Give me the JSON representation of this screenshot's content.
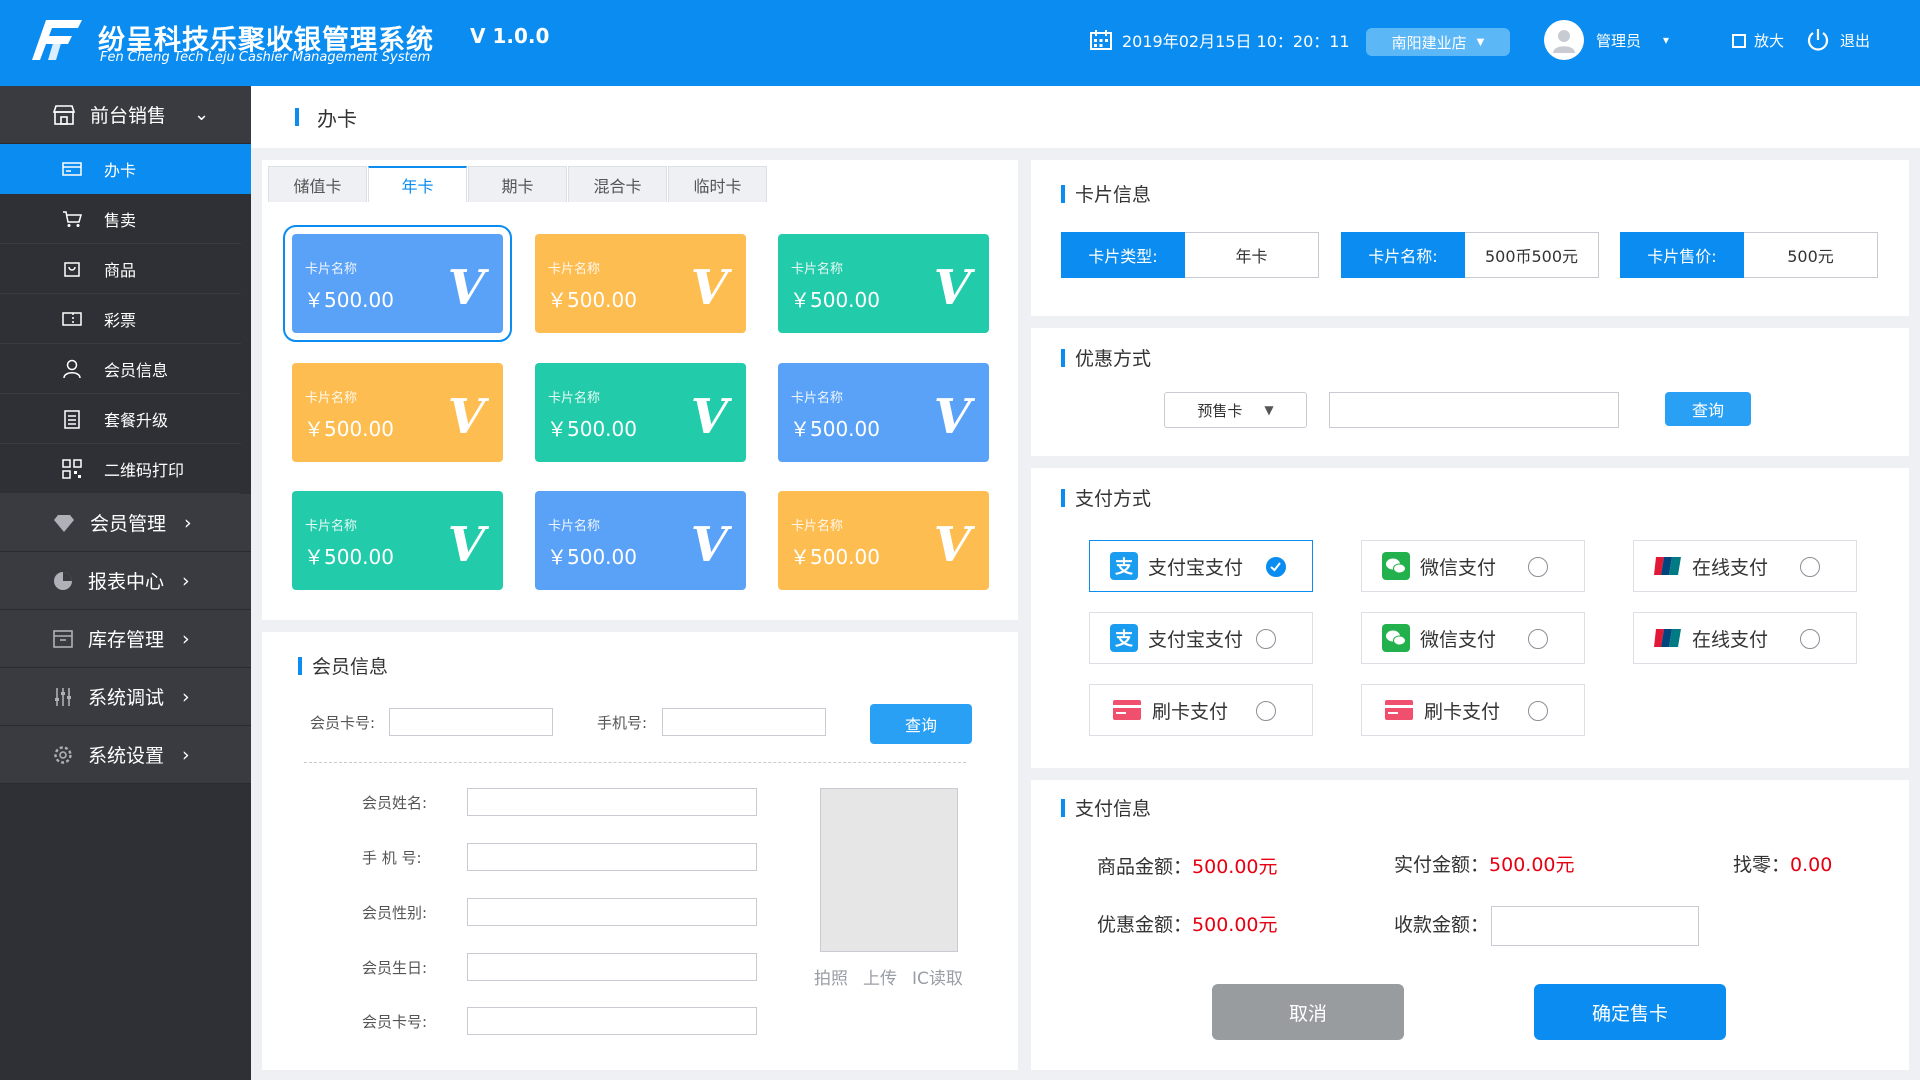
{
  "header": {
    "title": "纷呈科技乐聚收银管理系统",
    "subtitle": "Fen Cheng Tech Leju Cashier Management System",
    "version": "V 1.0.0",
    "datetime": "2019年02月15日  10：20：11",
    "store": "南阳建业店",
    "user": "管理员",
    "zoom_label": "放大",
    "exit_label": "退出",
    "brand_color": "#0a8cf0"
  },
  "sidebar": {
    "groups": [
      {
        "label": "前台销售",
        "icon": "store-icon"
      },
      {
        "label": "会员管理",
        "icon": "diamond-icon"
      },
      {
        "label": "报表中心",
        "icon": "pie-chart-icon"
      },
      {
        "label": "库存管理",
        "icon": "inventory-icon"
      },
      {
        "label": "系统调试",
        "icon": "sliders-icon"
      },
      {
        "label": "系统设置",
        "icon": "gear-icon"
      }
    ],
    "items": [
      {
        "label": "办卡",
        "icon": "card-icon"
      },
      {
        "label": "售卖",
        "icon": "cart-icon"
      },
      {
        "label": "商品",
        "icon": "bag-icon"
      },
      {
        "label": "彩票",
        "icon": "ticket-icon"
      },
      {
        "label": "会员信息",
        "icon": "person-icon"
      },
      {
        "label": "套餐升级",
        "icon": "list-icon"
      },
      {
        "label": "二维码打印",
        "icon": "qrcode-icon"
      }
    ]
  },
  "page": {
    "title": "办卡"
  },
  "tabs": [
    "储值卡",
    "年卡",
    "期卡",
    "混合卡",
    "临时卡"
  ],
  "cards": {
    "name_label": "卡片名称",
    "price": "￥500.00",
    "badge": "V",
    "colors": {
      "blue": "#5aa2f7",
      "orange": "#fdbd50",
      "green": "#22ccaa"
    },
    "items": [
      {
        "color": "blue"
      },
      {
        "color": "orange"
      },
      {
        "color": "green"
      },
      {
        "color": "orange"
      },
      {
        "color": "green"
      },
      {
        "color": "blue"
      },
      {
        "color": "green"
      },
      {
        "color": "blue"
      },
      {
        "color": "orange"
      }
    ]
  },
  "member": {
    "title": "会员信息",
    "card_no_label": "会员卡号:",
    "phone_label": "手机号:",
    "query_label": "查询",
    "fields": [
      "会员姓名:",
      "手 机 号:",
      "会员性别:",
      "会员生日:",
      "会员卡号:"
    ],
    "photo_actions": [
      "拍照",
      "上传",
      "IC读取"
    ]
  },
  "card_info": {
    "title": "卡片信息",
    "type_label": "卡片类型:",
    "type_value": "年卡",
    "name_label": "卡片名称:",
    "name_value": "500币500元",
    "price_label": "卡片售价:",
    "price_value": "500元"
  },
  "discount": {
    "title": "优惠方式",
    "select_value": "预售卡",
    "query_label": "查询"
  },
  "payment": {
    "title": "支付方式",
    "options": [
      {
        "label": "支付宝支付",
        "icon": "alipay-icon",
        "selected": true
      },
      {
        "label": "微信支付",
        "icon": "wechat-icon",
        "selected": false
      },
      {
        "label": "在线支付",
        "icon": "unionpay-icon",
        "selected": false
      },
      {
        "label": "支付宝支付",
        "icon": "alipay-icon",
        "selected": false
      },
      {
        "label": "微信支付",
        "icon": "wechat-icon",
        "selected": false
      },
      {
        "label": "在线支付",
        "icon": "unionpay-icon",
        "selected": false
      },
      {
        "label": "刷卡支付",
        "icon": "bank-card-icon",
        "selected": false
      },
      {
        "label": "刷卡支付",
        "icon": "bank-card-icon",
        "selected": false
      }
    ]
  },
  "pay_info": {
    "title": "支付信息",
    "goods_label": "商品金额：",
    "goods_value": "500.00元",
    "actual_label": "实付金额：",
    "actual_value": "500.00元",
    "change_label": "找零：",
    "change_value": "0.00",
    "discount_label": "优惠金额：",
    "discount_value": "500.00元",
    "received_label": "收款金额：",
    "cancel_label": "取消",
    "confirm_label": "确定售卡"
  }
}
